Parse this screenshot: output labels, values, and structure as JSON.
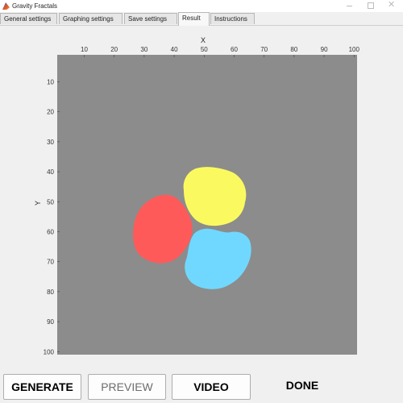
{
  "window": {
    "title": "Gravity Fractals",
    "icon": "matlab-icon",
    "controls": [
      "minimize-icon",
      "maximize-icon",
      "close-icon"
    ],
    "close_glyph": "✕"
  },
  "tabs": [
    {
      "label": "General settings",
      "active": false
    },
    {
      "label": "Graphing settings",
      "active": false
    },
    {
      "label": "Save settings",
      "active": false
    },
    {
      "label": "Result",
      "active": true
    },
    {
      "label": "Instructions",
      "active": false
    }
  ],
  "plot": {
    "xlabel": "X",
    "ylabel": "Y",
    "x_ticks": [
      "10",
      "20",
      "30",
      "40",
      "50",
      "60",
      "70",
      "80",
      "90",
      "100"
    ],
    "y_ticks": [
      "10",
      "20",
      "30",
      "40",
      "50",
      "60",
      "70",
      "80",
      "90",
      "100"
    ],
    "xlim": [
      1,
      101
    ],
    "ylim": [
      1,
      101
    ],
    "y_direction": "reversed",
    "x_axis_location": "top",
    "background_color": "#8c8c8c",
    "regions": [
      {
        "color": "#fafa60",
        "center": [
          53,
          43
        ]
      },
      {
        "color": "#ff5a5a",
        "center": [
          37,
          52
        ]
      },
      {
        "color": "#70d8ff",
        "center": [
          54,
          62
        ]
      }
    ]
  },
  "buttons": {
    "generate": "GENERATE",
    "preview": "PREVIEW",
    "video": "VIDEO",
    "done": "DONE"
  }
}
